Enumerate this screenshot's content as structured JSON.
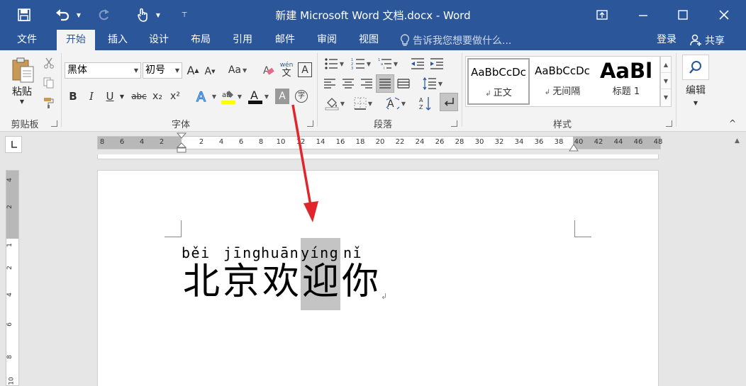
{
  "window": {
    "title": "新建 Microsoft Word 文档.docx - Word"
  },
  "tabs": [
    "文件",
    "开始",
    "插入",
    "设计",
    "布局",
    "引用",
    "邮件",
    "审阅",
    "视图"
  ],
  "tell_me": "告诉我您想要做什么...",
  "signin": "登录",
  "share": "共享",
  "clipboard": {
    "paste": "粘贴",
    "label": "剪贴板"
  },
  "font": {
    "name": "黑体",
    "size": "初号",
    "label": "字体",
    "aa": "Aa",
    "bold": "B",
    "italic": "I",
    "underline": "U",
    "strike": "abc",
    "sub": "x₂",
    "sup": "x²",
    "phonetic_top": "wén",
    "phonetic_bottom": "文",
    "border_char": "A",
    "circle_char": "字"
  },
  "paragraph": {
    "label": "段落"
  },
  "styles": {
    "label": "样式",
    "items": [
      {
        "preview": "AaBbCcDc",
        "name": "正文"
      },
      {
        "preview": "AaBbCcDc",
        "name": "无间隔"
      },
      {
        "preview": "AaBl",
        "name": "标题 1"
      }
    ]
  },
  "editing": {
    "label": "编辑"
  },
  "ruler": {
    "h": [
      "8",
      "6",
      "4",
      "2",
      "2",
      "4",
      "6",
      "8",
      "10",
      "12",
      "14",
      "16",
      "18",
      "20",
      "22",
      "24",
      "26",
      "28",
      "30",
      "32",
      "34",
      "36",
      "38",
      "40",
      "42",
      "44",
      "46",
      "48"
    ],
    "v": [
      "4",
      "2",
      "1",
      "2",
      "4",
      "6",
      "8",
      "10"
    ]
  },
  "document": {
    "pinyin": [
      "běi",
      "jīng",
      "huān",
      "yíng",
      "nǐ"
    ],
    "hanzi": [
      "北",
      "京",
      "欢",
      "迎",
      "你"
    ]
  },
  "colors": {
    "accent": "#2b579a",
    "arrow": "#e0262b",
    "highlight": "#c4c4c4"
  }
}
